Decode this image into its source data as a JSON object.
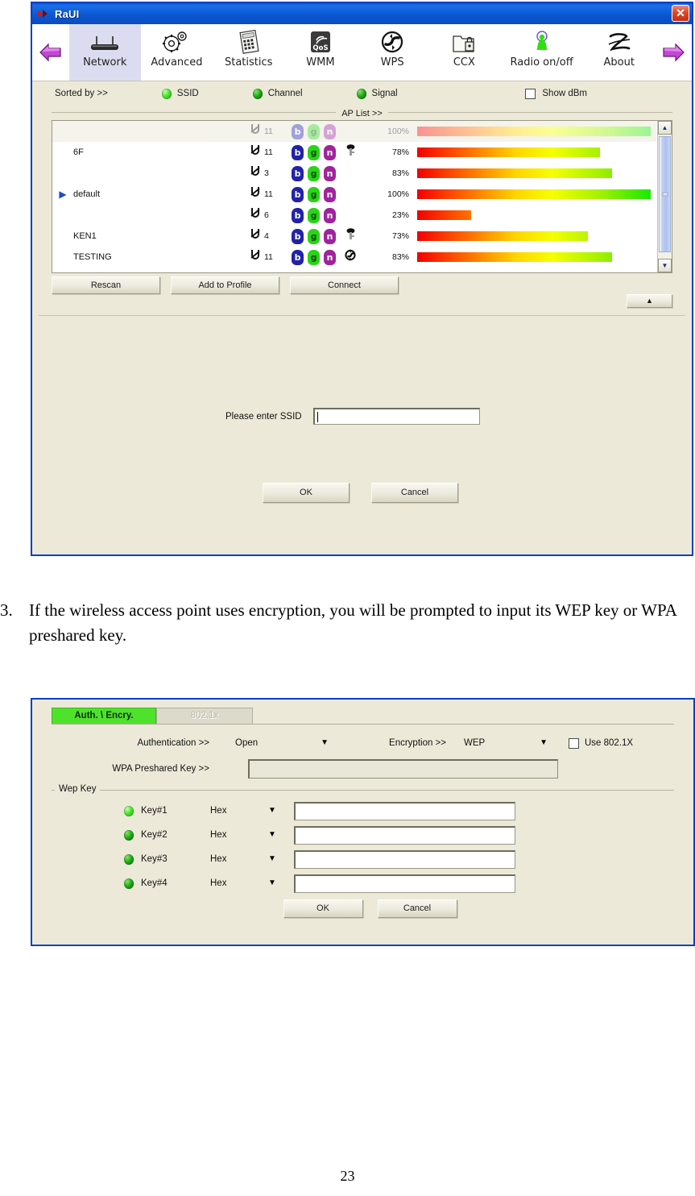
{
  "window1": {
    "title": "RaUI",
    "close_label": "✕",
    "toolbar": {
      "back_icon": "back-arrow-icon",
      "forward_icon": "forward-arrow-icon",
      "items": [
        {
          "label": "Network",
          "icon": "router-icon",
          "active": true
        },
        {
          "label": "Advanced",
          "icon": "gears-icon",
          "active": false
        },
        {
          "label": "Statistics",
          "icon": "calculator-icon",
          "active": false
        },
        {
          "label": "WMM",
          "icon": "qos-icon",
          "active": false
        },
        {
          "label": "WPS",
          "icon": "wps-icon",
          "active": false
        },
        {
          "label": "CCX",
          "icon": "folder-lock-icon",
          "active": false
        },
        {
          "label": "Radio on/off",
          "icon": "radio-tower-icon",
          "active": false
        },
        {
          "label": "About",
          "icon": "signature-icon",
          "active": false
        }
      ]
    },
    "sortbar": {
      "sorted_by_label": "Sorted by >>",
      "options": [
        {
          "label": "SSID",
          "selected": true
        },
        {
          "label": "Channel",
          "selected": false
        },
        {
          "label": "Signal",
          "selected": false
        }
      ],
      "show_dbm_label": "Show dBm",
      "show_dbm_checked": false
    },
    "ap_list": {
      "divider_label": "AP List >>",
      "rows": [
        {
          "ssid": "",
          "channel": "11",
          "b": "b",
          "g": "g",
          "n": "n",
          "security": "",
          "signal": "100%",
          "signal_value": 100,
          "selected": true,
          "faded": true,
          "arrow": false
        },
        {
          "ssid": "6F",
          "channel": "11",
          "b": "b",
          "g": "g",
          "n": "n",
          "security": "key",
          "signal": "78%",
          "signal_value": 78,
          "selected": false,
          "faded": false,
          "arrow": false
        },
        {
          "ssid": "",
          "channel": "3",
          "b": "b",
          "g": "g",
          "n": "n",
          "security": "",
          "signal": "83%",
          "signal_value": 83,
          "selected": false,
          "faded": false,
          "arrow": false
        },
        {
          "ssid": "default",
          "channel": "11",
          "b": "b",
          "g": "g",
          "n": "n",
          "security": "",
          "signal": "100%",
          "signal_value": 100,
          "selected": false,
          "faded": false,
          "arrow": true
        },
        {
          "ssid": "",
          "channel": "6",
          "b": "b",
          "g": "g",
          "n": "n",
          "security": "",
          "signal": "23%",
          "signal_value": 23,
          "selected": false,
          "faded": false,
          "arrow": false
        },
        {
          "ssid": "KEN1",
          "channel": "4",
          "b": "b",
          "g": "g",
          "n": "n",
          "security": "key",
          "signal": "73%",
          "signal_value": 73,
          "selected": false,
          "faded": false,
          "arrow": false
        },
        {
          "ssid": "TESTING",
          "channel": "11",
          "b": "b",
          "g": "g",
          "n": "n",
          "security": "wps",
          "signal": "83%",
          "signal_value": 83,
          "selected": false,
          "faded": false,
          "arrow": false
        }
      ]
    },
    "buttons": {
      "rescan": "Rescan",
      "add_to_profile": "Add to Profile",
      "connect": "Connect",
      "collapse": "▲"
    },
    "ssid_prompt": {
      "label": "Please enter SSID",
      "value": "",
      "ok": "OK",
      "cancel": "Cancel"
    }
  },
  "paragraph": {
    "number": "3.",
    "text": "If the wireless access point uses encryption, you will be prompted to input its WEP key or WPA preshared key."
  },
  "window2": {
    "tabs": [
      {
        "label": "Auth. \\ Encry.",
        "state": "active"
      },
      {
        "label": "802.1x",
        "state": "disabled"
      }
    ],
    "authentication": {
      "label": "Authentication >>",
      "value": "Open"
    },
    "encryption": {
      "label": "Encryption >>",
      "value": "WEP"
    },
    "use_8021x": {
      "label": "Use 802.1X",
      "checked": false
    },
    "wpa_preshared_key": {
      "label": "WPA Preshared Key >>",
      "value": "",
      "enabled": false
    },
    "wep_key": {
      "group_label": "Wep Key",
      "keys": [
        {
          "name": "Key#1",
          "format": "Hex",
          "value": "",
          "selected": true
        },
        {
          "name": "Key#2",
          "format": "Hex",
          "value": "",
          "selected": false
        },
        {
          "name": "Key#3",
          "format": "Hex",
          "value": "",
          "selected": false
        },
        {
          "name": "Key#4",
          "format": "Hex",
          "value": "",
          "selected": false
        }
      ]
    },
    "ok": "OK",
    "cancel": "Cancel"
  },
  "page_number": "23"
}
